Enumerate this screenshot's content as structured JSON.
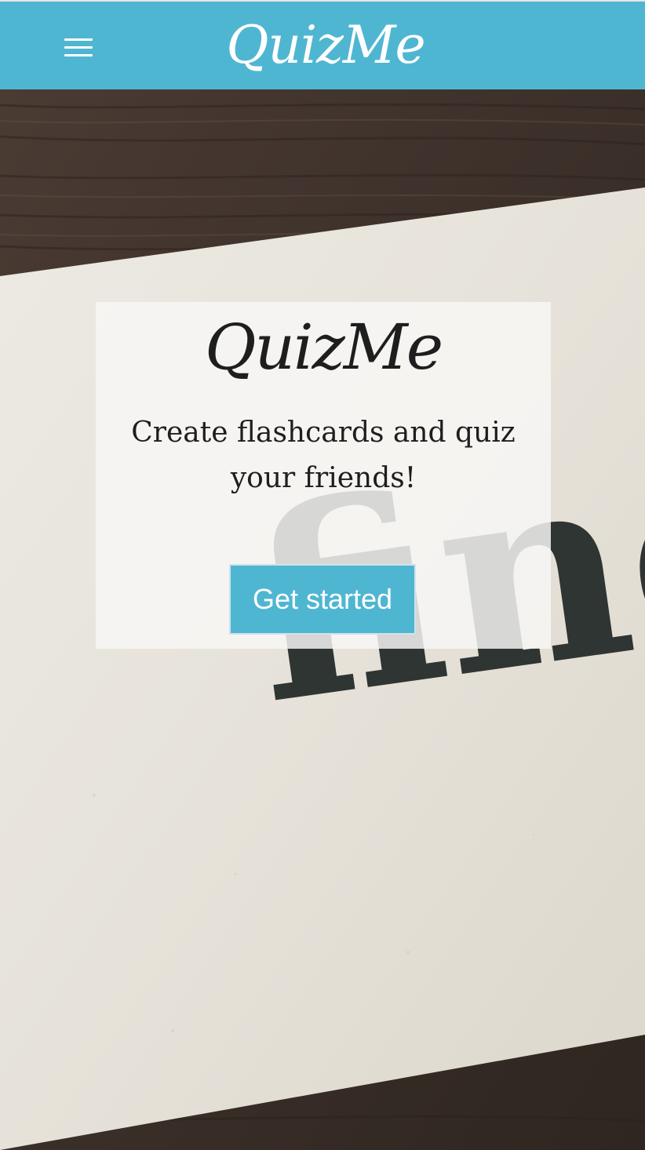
{
  "navbar": {
    "brand": "QuizMe",
    "menu_icon": "hamburger-menu-icon",
    "background": "#4fb6d2"
  },
  "hero": {
    "background_word": "finc",
    "card": {
      "title": "QuizMe",
      "tagline": "Create flashcards and quiz your friends!",
      "cta_label": "Get started"
    }
  },
  "colors": {
    "accent": "#4fb6d2",
    "text": "#1e1e1e",
    "paper": "#e9e6df",
    "wood": "#3a2f29"
  }
}
